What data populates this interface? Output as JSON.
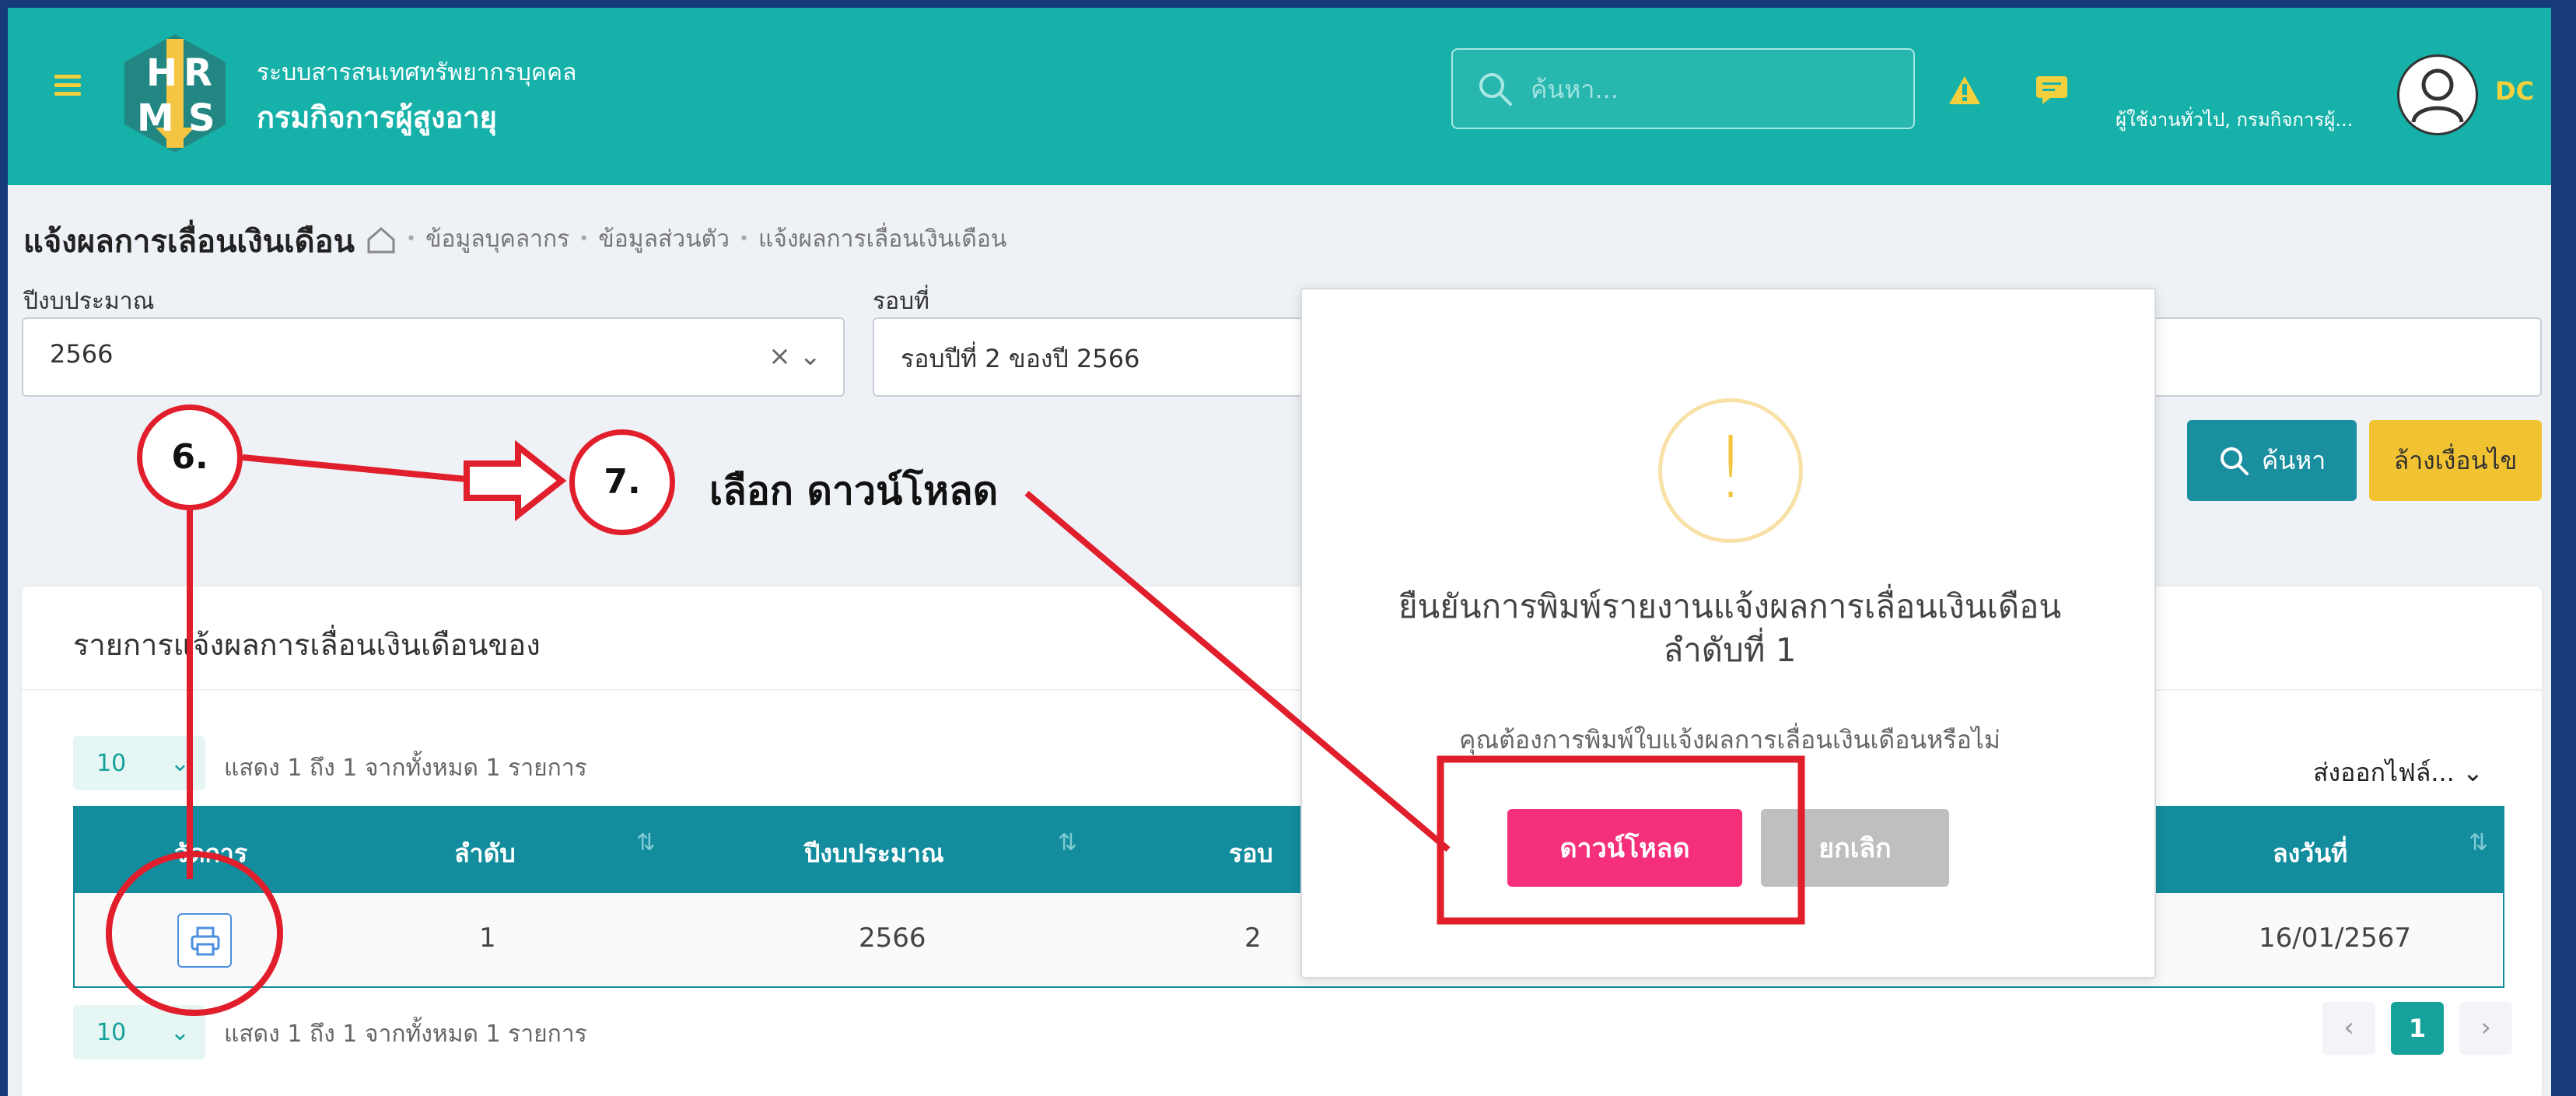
{
  "header": {
    "org_subtitle": "ระบบสารสนเทศทรัพยากรบุคคล",
    "org_name": "กรมกิจการผู้สูงอายุ",
    "search_placeholder": "ค้นหา...",
    "user_name": "ผู้ใช้งานทั่วไป, กรมกิจการผู้...",
    "user_initials": "DC",
    "logo_letters": [
      "H",
      "R",
      "M",
      "S"
    ]
  },
  "breadcrumb": {
    "title": "แจ้งผลการเลื่อนเงินเดือน",
    "items": [
      "ข้อมูลบุคลากร",
      "ข้อมูลส่วนตัว",
      "แจ้งผลการเลื่อนเงินเดือน"
    ]
  },
  "filters": {
    "year_label": "ปีงบประมาณ",
    "year_value": "2566",
    "round_label": "รอบที่",
    "round_value": "รอบปีที่ 2 ของปี 2566",
    "search_button": "ค้นหา",
    "clear_button": "ล้างเงื่อนไข"
  },
  "card": {
    "title": "รายการแจ้งผลการเลื่อนเงินเดือนของ",
    "page_length": "10",
    "info_top": "แสดง 1 ถึง 1 จากทั้งหมด 1 รายการ",
    "info_bottom": "แสดง 1 ถึง 1 จากทั้งหมด 1 รายการ",
    "export_label": "ส่งออกไฟล์...",
    "columns": [
      "จัดการ",
      "ลำดับ",
      "ปีงบประมาณ",
      "รอบ",
      "ลงวันที่"
    ],
    "rows": [
      {
        "order": "1",
        "year": "2566",
        "round": "2",
        "date": "16/01/2567"
      }
    ],
    "pager": {
      "prev": "‹",
      "current": "1",
      "next": "›"
    }
  },
  "modal": {
    "icon": "!",
    "title_line1": "ยืนยันการพิมพ์รายงานแจ้งผลการเลื่อนเงินเดือน",
    "title_line2": "ลำดับที่ 1",
    "message": "คุณต้องการพิมพ์ใบแจ้งผลการเลื่อนเงินเดือนหรือไม่",
    "confirm_label": "ดาวน์โหลด",
    "cancel_label": "ยกเลิก"
  },
  "annotations": {
    "step6": "6.",
    "step7": "7.",
    "instruction": "เลือก ดาวน์โหลด"
  },
  "colors": {
    "header_bg": "#16b1a9",
    "table_header_bg": "#138d9e",
    "download_button": "#f52f7a",
    "clear_button": "#f1c232",
    "annotation_red": "#e11e2b"
  }
}
